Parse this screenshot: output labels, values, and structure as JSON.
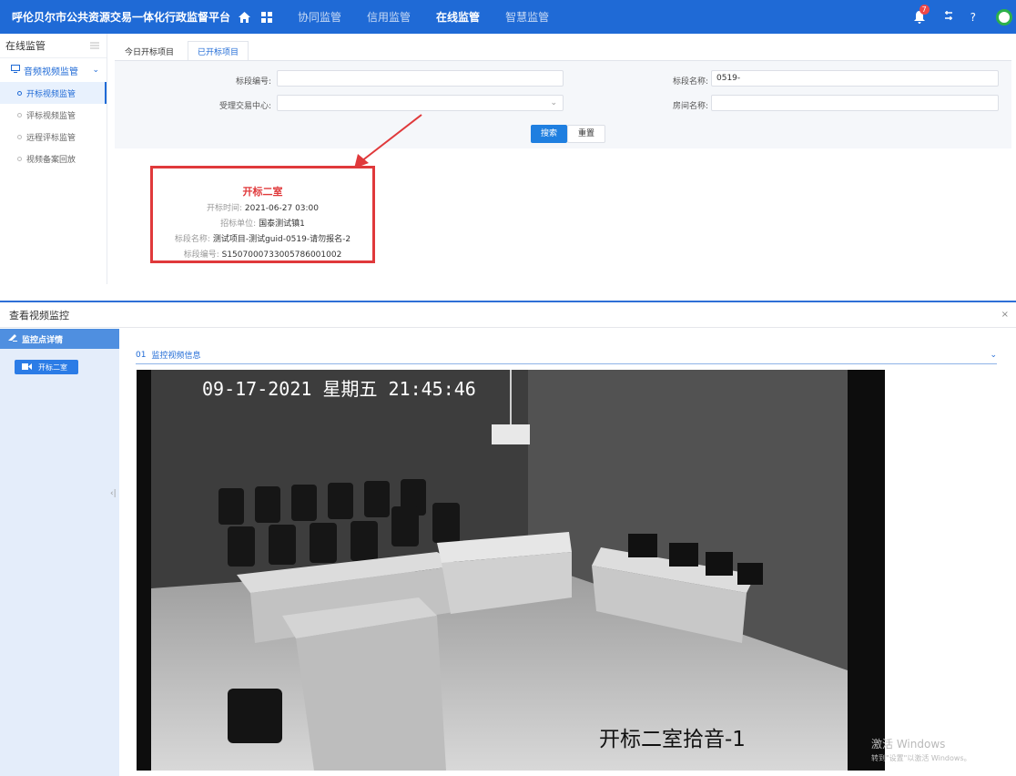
{
  "app": {
    "title": "呼伦贝尔市公共资源交易一体化行政监督平台",
    "nav": [
      "协同监管",
      "信用监管",
      "在线监管",
      "智慧监管"
    ],
    "nav_active_index": 2,
    "notification_count": "7",
    "top_icons": [
      "home-icon",
      "apps-grid-icon",
      "bell-icon",
      "settings-icon",
      "help-icon",
      "user-avatar"
    ],
    "help_label": "?",
    "colors": {
      "primary": "#1f6ad6",
      "highlight": "#e0393b",
      "button": "#1f7fe0"
    }
  },
  "sidebar": {
    "title": "在线监管",
    "group": "音频视频监管",
    "items": [
      "开标视频监管",
      "评标视频监管",
      "远程评标监管",
      "视频备案回放"
    ],
    "active_index": 0
  },
  "tabs": [
    "今日开标项目",
    "已开标项目"
  ],
  "active_tab": 1,
  "form": {
    "section_no_label": "标段编号:",
    "section_no_value": "",
    "center_label": "受理交易中心:",
    "center_value": "",
    "section_name_label": "标段名称:",
    "section_name_value": "0519-",
    "room_label": "房间名称:",
    "room_value": "",
    "search_button": "搜索",
    "reset_button": "重置"
  },
  "popup": {
    "title": "开标二室",
    "rows": [
      {
        "label": "开标时间:",
        "value": "2021-06-27 03:00"
      },
      {
        "label": "招标单位:",
        "value": "国泰测试镇1"
      },
      {
        "label": "标段名称:",
        "value": "测试项目-测试guid-0519-请勿报名-2"
      },
      {
        "label": "标段编号:",
        "value": "S1507000733005786001002"
      }
    ]
  },
  "dialog": {
    "title": "查看视频监控",
    "close": "×",
    "sidebar_title": "监控点详情",
    "room_item": "开标二室",
    "collapse": "‹|",
    "section_number": "01",
    "section_title": "监控视频信息",
    "video_timestamp": "09-17-2021 星期五 21:45:46",
    "video_camera_label": "开标二室拾音-1"
  },
  "watermark": {
    "line1": "激活 Windows",
    "line2": "转到\"设置\"以激活 Windows。"
  }
}
